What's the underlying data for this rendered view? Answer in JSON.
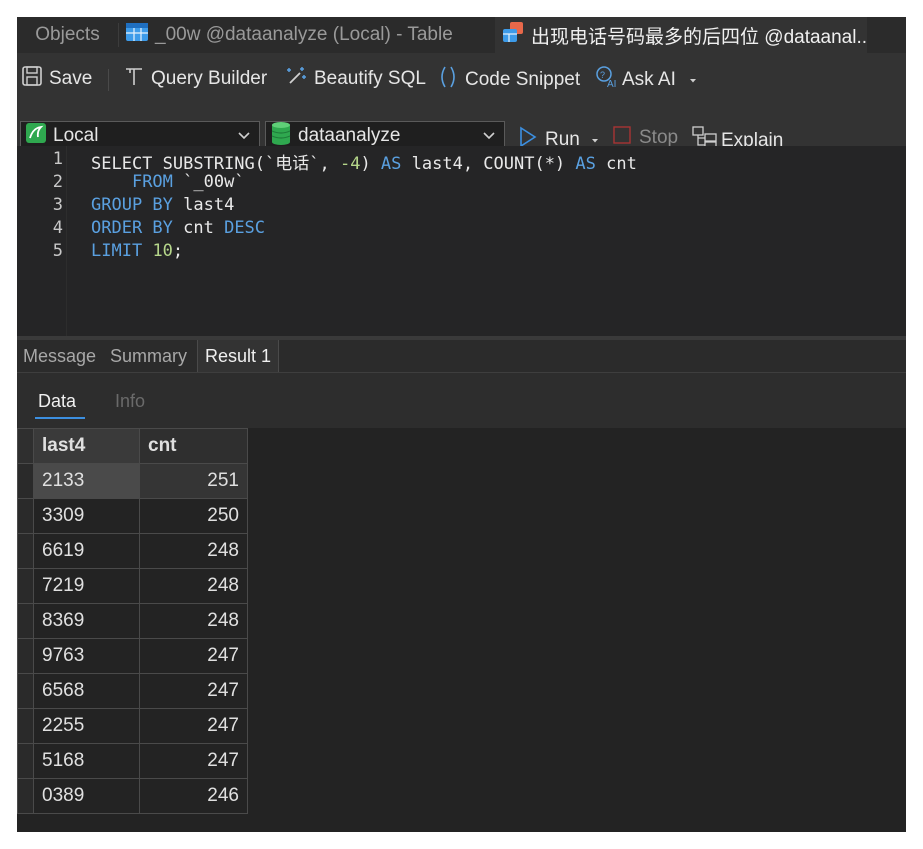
{
  "tabs": [
    {
      "label": "Objects",
      "icon": "none"
    },
    {
      "label": "_00w @dataanalyze (Local) - Table",
      "icon": "table-icon"
    },
    {
      "label": "出现电话号码最多的后四位 @dataanal...",
      "icon": "query-icon"
    }
  ],
  "toolbar": {
    "save": "Save",
    "query_builder": "Query Builder",
    "beautify": "Beautify SQL",
    "snippet": "Code Snippet",
    "ask_ai": "Ask AI",
    "connection": "Local",
    "database": "dataanalyze",
    "run": "Run",
    "stop": "Stop",
    "explain": "Explain"
  },
  "editor": {
    "line_numbers": [
      "1",
      "2",
      "3",
      "4",
      "5"
    ],
    "lines": [
      [
        {
          "t": "SELECT",
          "k": "plain"
        },
        {
          "t": " SUBSTRING(`电话`, ",
          "k": "plain"
        },
        {
          "t": "-4",
          "k": "num"
        },
        {
          "t": ") ",
          "k": "plain"
        },
        {
          "t": "AS",
          "k": "kw"
        },
        {
          "t": " last4, COUNT(*) ",
          "k": "plain"
        },
        {
          "t": "AS",
          "k": "kw"
        },
        {
          "t": " cnt",
          "k": "plain"
        }
      ],
      [
        {
          "t": "    ",
          "k": "plain"
        },
        {
          "t": "FROM",
          "k": "kw"
        },
        {
          "t": " `_00w`",
          "k": "plain"
        }
      ],
      [
        {
          "t": "GROUP BY",
          "k": "kw"
        },
        {
          "t": " last4",
          "k": "plain"
        }
      ],
      [
        {
          "t": "ORDER BY",
          "k": "kw"
        },
        {
          "t": " cnt ",
          "k": "plain"
        },
        {
          "t": "DESC",
          "k": "kw"
        }
      ],
      [
        {
          "t": "LIMIT",
          "k": "kw"
        },
        {
          "t": " ",
          "k": "plain"
        },
        {
          "t": "10",
          "k": "num"
        },
        {
          "t": ";",
          "k": "plain"
        }
      ]
    ]
  },
  "result_tabs": [
    "Message",
    "Summary",
    "Result 1"
  ],
  "sub_tabs": [
    "Data",
    "Info"
  ],
  "colors": {
    "accent": "#3c8fe0",
    "keyword": "#5aa0e0",
    "number": "#b5d68a",
    "run": "#3c8fe0",
    "stop": "#c03a3a"
  },
  "grid": {
    "columns": [
      "last4",
      "cnt"
    ],
    "rows": [
      [
        "2133",
        "251"
      ],
      [
        "3309",
        "250"
      ],
      [
        "6619",
        "248"
      ],
      [
        "7219",
        "248"
      ],
      [
        "8369",
        "248"
      ],
      [
        "9763",
        "247"
      ],
      [
        "6568",
        "247"
      ],
      [
        "2255",
        "247"
      ],
      [
        "5168",
        "247"
      ],
      [
        "0389",
        "246"
      ]
    ]
  }
}
